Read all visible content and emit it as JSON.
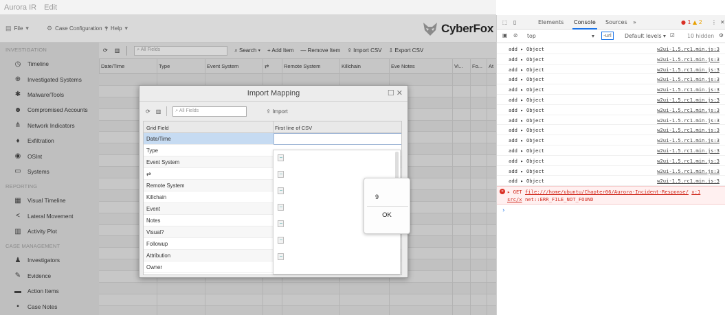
{
  "window": {
    "title_items": [
      "Aurora IR",
      "Edit"
    ]
  },
  "toolbar": {
    "file": "File",
    "case_configuration": "Case Configuration",
    "help": "Help",
    "brand": "CyberFox"
  },
  "sidebar": {
    "investigation_header": "INVESTIGATION",
    "investigation_items": [
      {
        "label": "Timeline",
        "icon": "clock-icon"
      },
      {
        "label": "Investigated Systems",
        "icon": "magnifier-icon"
      },
      {
        "label": "Malware/Tools",
        "icon": "bug-icon"
      },
      {
        "label": "Compromised Accounts",
        "icon": "users-icon"
      },
      {
        "label": "Network Indicators",
        "icon": "network-icon"
      },
      {
        "label": "Exfiltration",
        "icon": "fire-icon"
      },
      {
        "label": "OSInt",
        "icon": "globe-icon"
      },
      {
        "label": "Systems",
        "icon": "monitor-icon"
      }
    ],
    "reporting_header": "REPORTING",
    "reporting_items": [
      {
        "label": "Visual Timeline",
        "icon": "calendar-icon"
      },
      {
        "label": "Lateral Movement",
        "icon": "share-icon"
      },
      {
        "label": "Activity Plot",
        "icon": "bar-chart-icon"
      }
    ],
    "case_header": "CASE MANAGEMENT",
    "case_items": [
      {
        "label": "Investigators",
        "icon": "user-icon"
      },
      {
        "label": "Evidence",
        "icon": "pen-icon"
      },
      {
        "label": "Action Items",
        "icon": "inbox-icon"
      },
      {
        "label": "Case Notes",
        "icon": "note-icon"
      }
    ]
  },
  "grid": {
    "search_placeholder": "All Fields",
    "search_label": "Search",
    "add_item": "Add Item",
    "remove_item": "Remove Item",
    "import_csv": "Import CSV",
    "export_csv": "Export CSV",
    "columns": [
      "Date/Time",
      "Type",
      "Event System",
      "⇄",
      "Remote System",
      "Killchain",
      "Eve Notes",
      "Vi...",
      "Fo...",
      "At"
    ]
  },
  "modal": {
    "title": "Import Mapping",
    "search_placeholder": "All Fields",
    "import_label": "Import",
    "col_grid_field": "Grid Field",
    "col_first_line": "First line of CSV",
    "rows": [
      "Date/Time",
      "Type",
      "Event System",
      "⇄",
      "Remote System",
      "Killchain",
      "Event",
      "Notes",
      "Visual?",
      "Followup",
      "Attribution",
      "Owner"
    ]
  },
  "alert": {
    "message": "9",
    "ok_label": "OK"
  },
  "devtools": {
    "tabs": [
      "Elements",
      "Console",
      "Sources",
      "»"
    ],
    "active_tab": "Console",
    "error_count": "1",
    "warning_count": "2",
    "context": "top",
    "filter_value": "-url",
    "levels": "Default levels ▾",
    "hidden": "10 hidden",
    "log_rows": [
      {
        "message": "add ▸ Object",
        "source": "w2ui-1.5.rc1.min.js:3"
      },
      {
        "message": "add ▸ Object",
        "source": "w2ui-1.5.rc1.min.js:3"
      },
      {
        "message": "add ▸ Object",
        "source": "w2ui-1.5.rc1.min.js:3"
      },
      {
        "message": "add ▸ Object",
        "source": "w2ui-1.5.rc1.min.js:3"
      },
      {
        "message": "add ▸ Object",
        "source": "w2ui-1.5.rc1.min.js:3"
      },
      {
        "message": "add ▸ Object",
        "source": "w2ui-1.5.rc1.min.js:3"
      },
      {
        "message": "add ▸ Object",
        "source": "w2ui-1.5.rc1.min.js:3"
      },
      {
        "message": "add ▸ Object",
        "source": "w2ui-1.5.rc1.min.js:3"
      },
      {
        "message": "add ▸ Object",
        "source": "w2ui-1.5.rc1.min.js:3"
      },
      {
        "message": "add ▸ Object",
        "source": "w2ui-1.5.rc1.min.js:3"
      },
      {
        "message": "add ▸ Object",
        "source": "w2ui-1.5.rc1.min.js:3"
      },
      {
        "message": "add ▸ Object",
        "source": "w2ui-1.5.rc1.min.js:3"
      },
      {
        "message": "add ▸ Object",
        "source": "w2ui-1.5.rc1.min.js:3"
      },
      {
        "message": "add ▸ Object",
        "source": "w2ui-1.5.rc1.min.js:3"
      }
    ],
    "error": {
      "method": "▸ GET",
      "url": "file:///home/ubuntu/Chapter06/Aurora-Incident-Response/",
      "src_ref": "x:1",
      "url2": "src/x",
      "message": "net::ERR_FILE_NOT_FOUND"
    },
    "prompt": "›"
  },
  "colors": {
    "accent": "#1a73e8",
    "error": "#d93025",
    "selection": "#c6dbf2"
  }
}
